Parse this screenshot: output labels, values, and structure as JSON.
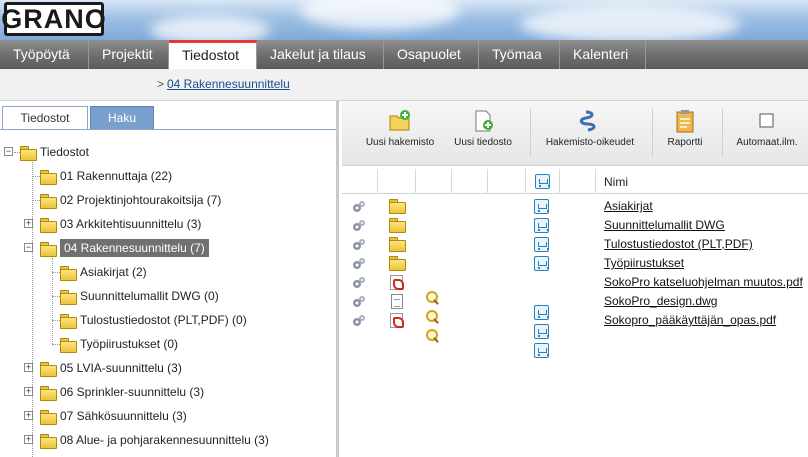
{
  "brand": {
    "logo_text": "GRANO"
  },
  "nav": {
    "tabs": [
      {
        "label": "Työpöytä"
      },
      {
        "label": "Projektit"
      },
      {
        "label": "Tiedostot"
      },
      {
        "label": "Jakelut ja tilaus"
      },
      {
        "label": "Osapuolet"
      },
      {
        "label": "Työmaa"
      },
      {
        "label": "Kalenteri"
      }
    ],
    "active": "Tiedostot"
  },
  "breadcrumb": {
    "separator": ">",
    "current": "04 Rakennesuunnittelu"
  },
  "left_panel": {
    "tabs": [
      {
        "label": "Tiedostot"
      },
      {
        "label": "Haku"
      }
    ],
    "tree": {
      "root": "Tiedostot",
      "items": [
        {
          "label": "01 Rakennuttaja (22)"
        },
        {
          "label": "02 Projektinjohtourakoitsija (7)"
        },
        {
          "label": "03 Arkkitehtisuunnittelu (3)"
        },
        {
          "label": "04 Rakennesuunnittelu (7)"
        },
        {
          "label": "Asiakirjat (2)"
        },
        {
          "label": "Suunnittelumallit DWG (0)"
        },
        {
          "label": "Tulostustiedostot (PLT,PDF) (0)"
        },
        {
          "label": "Työpiirustukset (0)"
        },
        {
          "label": "05 LVIA-suunnittelu (3)"
        },
        {
          "label": "06 Sprinkler-suunnittelu (3)"
        },
        {
          "label": "07 Sähkösuunnittelu (3)"
        },
        {
          "label": "08 Alue- ja pohjarakennesuunnittelu (3)"
        }
      ]
    }
  },
  "toolbar": {
    "new_folder": "Uusi hakemisto",
    "new_file": "Uusi tiedosto",
    "folder_rights": "Hakemisto-oikeudet",
    "report": "Raportti",
    "auto_label": "Automaat.ilm."
  },
  "file_list": {
    "column_name": "Nimi",
    "rows": [
      {
        "name": "Asiakirjat",
        "type": "folder"
      },
      {
        "name": "Suunnittelumallit DWG",
        "type": "folder"
      },
      {
        "name": "Tulostustiedostot (PLT,PDF)",
        "type": "folder"
      },
      {
        "name": "Työpiirustukset",
        "type": "folder"
      },
      {
        "name": "SokoPro katseluohjelman muutos.pdf",
        "type": "pdf"
      },
      {
        "name": "SokoPro_design.dwg",
        "type": "dwg"
      },
      {
        "name": "Sokopro_pääkäyttäjän_opas.pdf",
        "type": "pdf"
      }
    ]
  },
  "colors": {
    "nav_active_accent": "#e23a35",
    "link": "#1a4e8c",
    "tab_inactive": "#7a9fcd",
    "selected_row": "#707070"
  }
}
